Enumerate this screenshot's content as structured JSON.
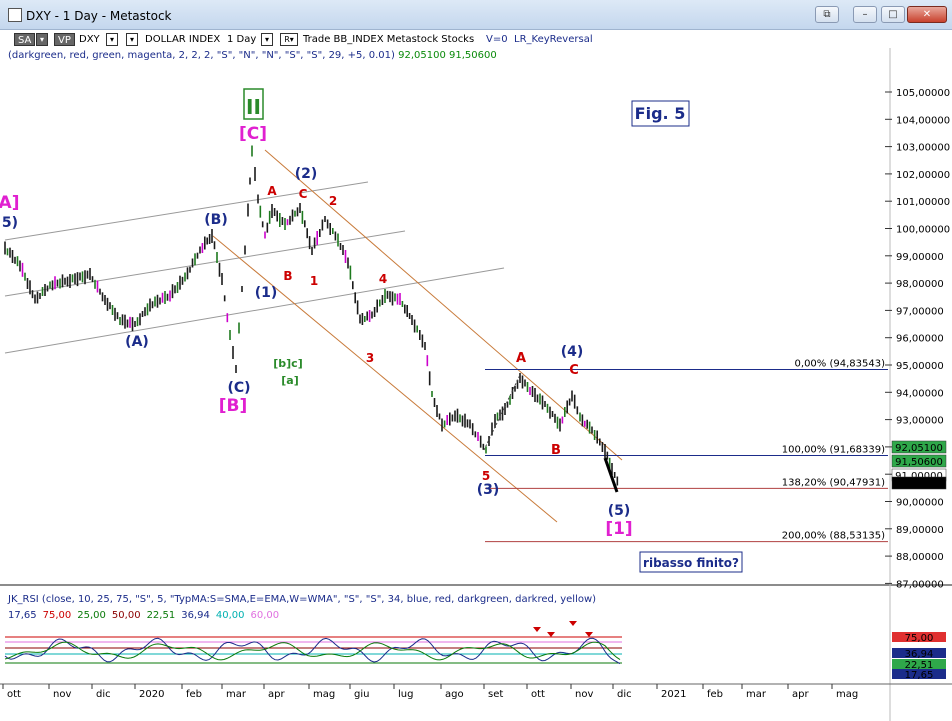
{
  "window": {
    "title": "DXY - 1 Day - Metastock",
    "buttons": {
      "restore": "⧉",
      "minimize": "–",
      "maximize": "□",
      "close": "✕"
    }
  },
  "toolbar": {
    "sa": "SA",
    "vp": "VP",
    "symbol": "DXY",
    "name": "DOLLAR INDEX",
    "period": "1 Day",
    "r_label": "R",
    "info": "Trade  BB_INDEX  Metastock  Stocks",
    "volume": "V=0",
    "indicator": "LR_KeyReversal"
  },
  "paramline": {
    "text": "(darkgreen, red, green, magenta, 2, 2, 2, \"S\", \"N\", \"N\", \"S\", \"S\", 29, +5, 0.01)",
    "val1": "92,05100",
    "val2": "91,50600"
  },
  "chart": {
    "price_ticks": [
      "105,00000",
      "104,00000",
      "103,00000",
      "102,00000",
      "101,00000",
      "100,00000",
      "99,00000",
      "98,00000",
      "97,00000",
      "96,00000",
      "95,00000",
      "94,00000",
      "93,00000",
      "92,00000",
      "91,00000",
      "90,00000",
      "89,00000",
      "88,00000",
      "87,00000"
    ],
    "fib_levels": [
      {
        "label": "0,00% (94,83543)",
        "price": 94.83543
      },
      {
        "label": "100,00% (91,68339)",
        "price": 91.68339
      },
      {
        "label": "138,20% (90,47931)",
        "price": 90.47931
      },
      {
        "label": "200,00% (88,53135)",
        "price": 88.53135
      }
    ],
    "price_badges": [
      {
        "value": "92,05100",
        "color": "#2fa84a"
      },
      {
        "value": "91,50600",
        "color": "#2fa84a"
      },
      {
        "value": "91,00000",
        "color": "#ffffff"
      },
      {
        "value": "90,70100",
        "color": "#000000"
      }
    ],
    "fig_label": "Fig. 5",
    "question": "ribasso finito?",
    "wave_labels": {
      "primary_II": "II",
      "c_bracket": "[C]",
      "b_bracket": "[B]",
      "one_bracket": "[1]",
      "a_bracket_left": "A]",
      "five_left": "5)",
      "wave_A": "(A)",
      "wave_B": "(B)",
      "wave_C": "(C)",
      "wave_1": "(1)",
      "wave_2": "(2)",
      "wave_3": "(3)",
      "wave_4": "(4)",
      "wave_5": "(5)",
      "minor_A1": "A",
      "minor_B1": "B",
      "minor_C1": "C",
      "minor_1": "1",
      "minor_2": "2",
      "minor_3": "3",
      "minor_4": "4",
      "minor_5": "5",
      "minor_A2": "A",
      "minor_B2": "B",
      "minor_C2": "C",
      "bc_label": "[b]c]",
      "a_small": "[a]"
    }
  },
  "date_axis": [
    "ott",
    "nov",
    "dic",
    "2020",
    "feb",
    "mar",
    "apr",
    "mag",
    "giu",
    "lug",
    "ago",
    "set",
    "ott",
    "nov",
    "dic",
    "2021",
    "feb",
    "mar",
    "apr",
    "mag"
  ],
  "rsi": {
    "params": "JK_RSI   (close, 10, 25, 75, \"S\", 5, \"TypMA:S=SMA,E=EMA,W=WMA\", \"S\", \"S\", 34, blue, red, darkgreen, darkred, yellow)",
    "values": [
      {
        "text": "17,65",
        "color": "#1b2c8a"
      },
      {
        "text": "75,00",
        "color": "#cc0000"
      },
      {
        "text": "25,00",
        "color": "#0a7a0a"
      },
      {
        "text": "50,00",
        "color": "#8b0000"
      },
      {
        "text": "22,51",
        "color": "#0a7a0a"
      },
      {
        "text": "36,94",
        "color": "#1b2c8a"
      },
      {
        "text": "40,00",
        "color": "#00b0b0"
      },
      {
        "text": "60,00",
        "color": "#e070e0"
      }
    ],
    "badges": [
      {
        "value": "75,00",
        "color": "#e03030"
      },
      {
        "value": "36,94",
        "color": "#1b2c8a"
      },
      {
        "value": "22,51",
        "color": "#2fa84a"
      },
      {
        "value": "17,65",
        "color": "#1b2c8a"
      }
    ]
  },
  "colors": {
    "wave_blue": "#1b2c8a",
    "wave_red": "#cc0000",
    "wave_magenta": "#e020d0",
    "wave_green": "#2a8a2a",
    "channel_orange": "#c87a3a",
    "channel_gray": "#888888",
    "fib_line": "#1b2c8a",
    "fib_200": "#b04040"
  }
}
